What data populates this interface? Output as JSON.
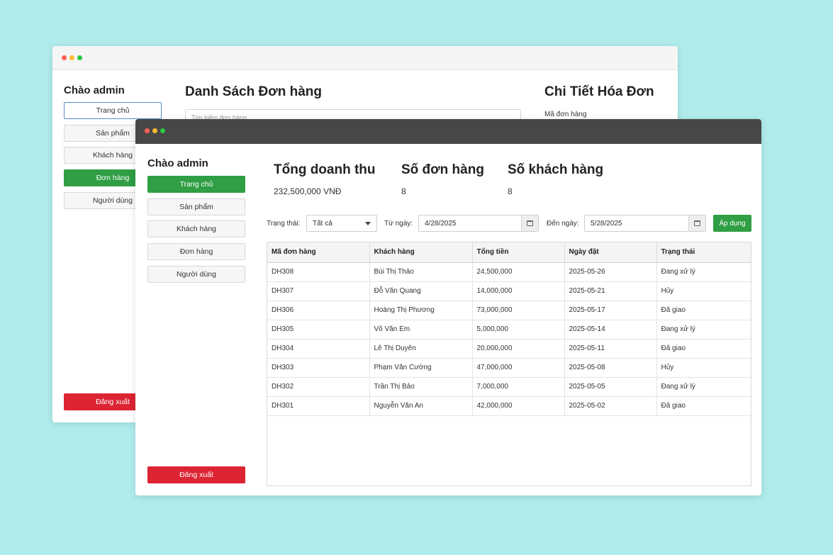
{
  "back_window": {
    "greeting": "Chào admin",
    "nav": [
      "Trang chủ",
      "Sản phẩm",
      "Khách hàng",
      "Đơn hàng",
      "Người dùng"
    ],
    "logout": "Đăng xuất",
    "title": "Danh Sách Đơn hàng",
    "search_placeholder": "Tìm kiếm đơn hàng...",
    "detail_title": "Chi Tiết Hóa Đơn",
    "detail_order_label": "Mã đơn hàng"
  },
  "front_window": {
    "greeting": "Chào admin",
    "nav": [
      "Trang chủ",
      "Sản phẩm",
      "Khách hàng",
      "Đơn hàng",
      "Người dùng"
    ],
    "logout": "Đăng xuất",
    "stats": [
      {
        "title": "Tổng doanh thu",
        "value": "232,500,000 VNĐ"
      },
      {
        "title": "Số đơn hàng",
        "value": "8"
      },
      {
        "title": "Số khách hàng",
        "value": "8"
      }
    ],
    "filters": {
      "status_label": "Trạng thái:",
      "status_value": "Tất cả",
      "from_label": "Từ ngày:",
      "from_value": "4/28/2025",
      "to_label": "Đến ngày:",
      "to_value": "5/28/2025",
      "apply_label": "Áp dụng"
    },
    "table": {
      "columns": [
        "Mã đơn hàng",
        "Khách hàng",
        "Tổng tiền",
        "Ngày đặt",
        "Trạng thái"
      ],
      "rows": [
        [
          "DH308",
          "Bùi Thị Thảo",
          "24,500,000",
          "2025-05-26",
          "Đang xử lý"
        ],
        [
          "DH307",
          "Đỗ Văn Quang",
          "14,000,000",
          "2025-05-21",
          "Hủy"
        ],
        [
          "DH306",
          "Hoàng Thị Phương",
          "73,000,000",
          "2025-05-17",
          "Đã giao"
        ],
        [
          "DH305",
          "Võ Văn Em",
          "5,000,000",
          "2025-05-14",
          "Đang xử lý"
        ],
        [
          "DH304",
          "Lê Thị Duyên",
          "20,000,000",
          "2025-05-11",
          "Đã giao"
        ],
        [
          "DH303",
          "Phạm Văn Cường",
          "47,000,000",
          "2025-05-08",
          "Hủy"
        ],
        [
          "DH302",
          "Trần Thị Bảo",
          "7,000,000",
          "2025-05-05",
          "Đang xử lý"
        ],
        [
          "DH301",
          "Nguyễn Văn An",
          "42,000,000",
          "2025-05-02",
          "Đã giao"
        ]
      ]
    }
  }
}
